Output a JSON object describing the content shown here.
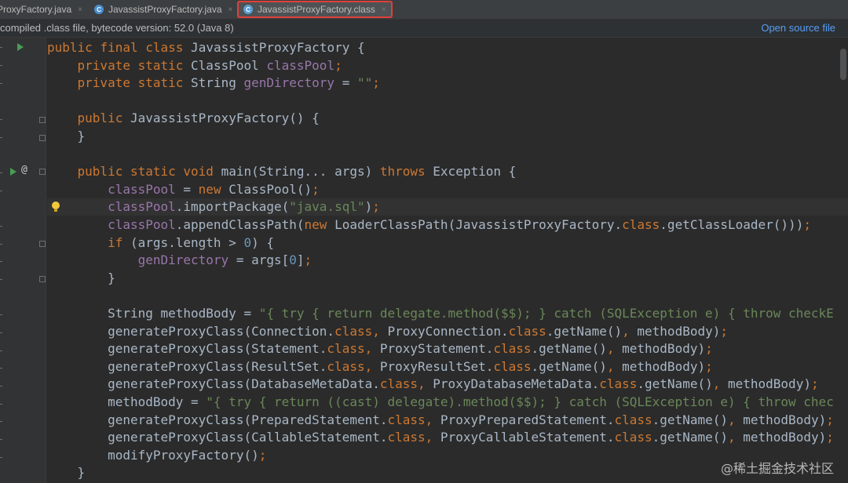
{
  "tabs": [
    {
      "label": "ProxyFactory.java",
      "icon": "java-class-icon",
      "active": false
    },
    {
      "label": "JavassistProxyFactory.java",
      "icon": "java-class-icon",
      "active": false
    },
    {
      "label": "JavassistProxyFactory.class",
      "icon": "class-file-icon",
      "active": true
    }
  ],
  "tab_close_glyph": "×",
  "banner": {
    "message": "compiled .class file, bytecode version: 52.0 (Java 8)",
    "link": "Open source file"
  },
  "code": {
    "lines": [
      "public final class JavassistProxyFactory {",
      "    private static ClassPool classPool;",
      "    private static String genDirectory = \"\";",
      "",
      "    public JavassistProxyFactory() {",
      "    }",
      "",
      "    public static void main(String... args) throws Exception {",
      "        classPool = new ClassPool();",
      "        classPool.importPackage(\"java.sql\");",
      "        classPool.appendClassPath(new LoaderClassPath(JavassistProxyFactory.class.getClassLoader()));",
      "        if (args.length > 0) {",
      "            genDirectory = args[0];",
      "        }",
      "",
      "        String methodBody = \"{ try { return delegate.method($$); } catch (SQLException e) { throw checkE",
      "        generateProxyClass(Connection.class, ProxyConnection.class.getName(), methodBody);",
      "        generateProxyClass(Statement.class, ProxyStatement.class.getName(), methodBody);",
      "        generateProxyClass(ResultSet.class, ProxyResultSet.class.getName(), methodBody);",
      "        generateProxyClass(DatabaseMetaData.class, ProxyDatabaseMetaData.class.getName(), methodBody);",
      "        methodBody = \"{ try { return ((cast) delegate).method($$); } catch (SQLException e) { throw chec",
      "        generateProxyClass(PreparedStatement.class, ProxyPreparedStatement.class.getName(), methodBody);",
      "        generateProxyClass(CallableStatement.class, ProxyCallableStatement.class.getName(), methodBody);",
      "        modifyProxyFactory();",
      "    }"
    ]
  },
  "gutter": {
    "at_symbol": "@"
  },
  "watermark": "@稀土掘金技术社区",
  "colors": {
    "keyword": "#cc7832",
    "string": "#6a8759",
    "number": "#6897bb",
    "field": "#9876aa",
    "link": "#589df6",
    "active_tab_border": "#e0403a"
  }
}
